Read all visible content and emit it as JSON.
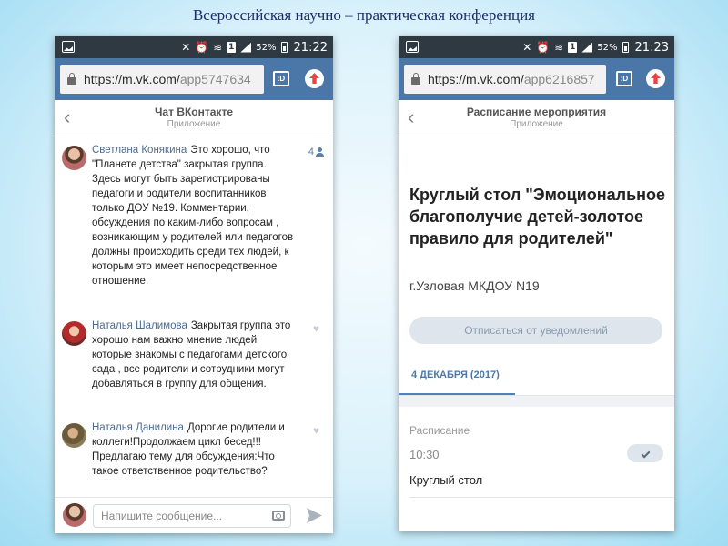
{
  "slide_title": "Всероссийская научно – практическая конференция",
  "left_phone": {
    "status": {
      "battery": "52%",
      "time": "21:22"
    },
    "url": {
      "host": "https://m.vk.com/",
      "path": "app5747634"
    },
    "header": {
      "title": "Чат ВКонтакте",
      "subtitle": "Приложение"
    },
    "messages": [
      {
        "author": "Светлана Конякина",
        "text": "Это хорошо, что \"Планете детства\" закрытая группа. Здесь могут быть зарегистрированы педагоги и родители воспитанников только ДОУ №19. Комментарии, обсуждения по каким-либо вопросам , возникающим у родителей или педагогов должны происходить среди тех людей, к которым это имеет непосредственное отношение.",
        "count": "4"
      },
      {
        "author": "Наталья Шалимова",
        "text": "Закрытая группа это хорошо нам важно мнение людей которые знакомы с педагогами детского сада , все родители и сотрудники могут добавляться в группу для общения."
      },
      {
        "author": "Наталья Данилина",
        "text": "Дорогие родители и коллеги!Продолжаем цикл бесед!!!Предлагаю тему для обсуждения:Что такое ответственное родительство?"
      }
    ],
    "composer": {
      "placeholder": "Напишите сообщение..."
    }
  },
  "right_phone": {
    "status": {
      "battery": "52%",
      "time": "21:23"
    },
    "url": {
      "host": "https://m.vk.com/",
      "path": "app6216857"
    },
    "header": {
      "title": "Расписание мероприятия",
      "subtitle": "Приложение"
    },
    "event": {
      "title": "Круглый стол \"Эмоциональное благополучие детей-золотое правило для родителей\"",
      "place": "г.Узловая МКДОУ N19",
      "unsubscribe_label": "Отписаться от уведомлений",
      "date_tab": "4 ДЕКАБРЯ (2017)",
      "schedule_label": "Расписание",
      "schedule_time": "10:30",
      "schedule_item": "Круглый стол"
    }
  }
}
